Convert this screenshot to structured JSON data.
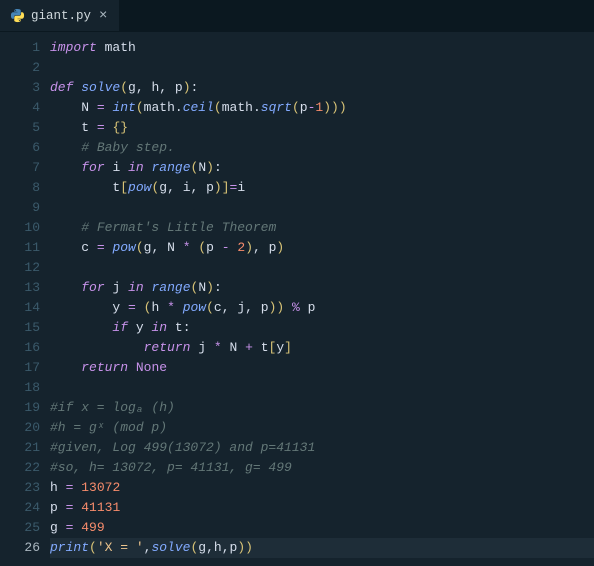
{
  "tab": {
    "filename": "giant.py",
    "icon": "python-icon",
    "close_glyph": "×"
  },
  "editor": {
    "current_line": 26,
    "lines": [
      {
        "n": 1,
        "tokens": [
          [
            "kw-import",
            "import"
          ],
          [
            "",
            ""
          ],
          [
            "ident",
            " math"
          ]
        ]
      },
      {
        "n": 2,
        "tokens": []
      },
      {
        "n": 3,
        "tokens": [
          [
            "kw-def",
            "def"
          ],
          [
            "",
            " "
          ],
          [
            "fn-name",
            "solve"
          ],
          [
            "punct",
            "("
          ],
          [
            "param",
            "g"
          ],
          [
            "punc-w",
            ", "
          ],
          [
            "param",
            "h"
          ],
          [
            "punc-w",
            ", "
          ],
          [
            "param",
            "p"
          ],
          [
            "punct",
            ")"
          ],
          [
            "punc-w",
            ":"
          ]
        ]
      },
      {
        "n": 4,
        "tokens": [
          [
            "",
            "    "
          ],
          [
            "ident",
            "N "
          ],
          [
            "op",
            "="
          ],
          [
            "",
            " "
          ],
          [
            "builtin",
            "int"
          ],
          [
            "punct",
            "("
          ],
          [
            "ident",
            "math"
          ],
          [
            "punc-w",
            "."
          ],
          [
            "fn-call",
            "ceil"
          ],
          [
            "punct",
            "("
          ],
          [
            "ident",
            "math"
          ],
          [
            "punc-w",
            "."
          ],
          [
            "fn-call",
            "sqrt"
          ],
          [
            "punct",
            "("
          ],
          [
            "ident",
            "p"
          ],
          [
            "op",
            "-"
          ],
          [
            "num",
            "1"
          ],
          [
            "punct",
            ")))"
          ]
        ]
      },
      {
        "n": 5,
        "tokens": [
          [
            "",
            "    "
          ],
          [
            "ident",
            "t "
          ],
          [
            "op",
            "="
          ],
          [
            "",
            " "
          ],
          [
            "brace",
            "{}"
          ]
        ]
      },
      {
        "n": 6,
        "tokens": [
          [
            "",
            "    "
          ],
          [
            "comment",
            "# Baby step."
          ]
        ]
      },
      {
        "n": 7,
        "tokens": [
          [
            "",
            "    "
          ],
          [
            "kw-flow",
            "for"
          ],
          [
            "",
            " "
          ],
          [
            "ident",
            "i"
          ],
          [
            "",
            " "
          ],
          [
            "kw-in",
            "in"
          ],
          [
            "",
            " "
          ],
          [
            "builtin",
            "range"
          ],
          [
            "punct",
            "("
          ],
          [
            "ident",
            "N"
          ],
          [
            "punct",
            ")"
          ],
          [
            "punc-w",
            ":"
          ]
        ]
      },
      {
        "n": 8,
        "tokens": [
          [
            "",
            "        "
          ],
          [
            "ident",
            "t"
          ],
          [
            "punct",
            "["
          ],
          [
            "builtin",
            "pow"
          ],
          [
            "punct",
            "("
          ],
          [
            "ident",
            "g"
          ],
          [
            "punc-w",
            ", "
          ],
          [
            "ident",
            "i"
          ],
          [
            "punc-w",
            ", "
          ],
          [
            "ident",
            "p"
          ],
          [
            "punct",
            ")]"
          ],
          [
            "op",
            "="
          ],
          [
            "ident",
            "i"
          ]
        ]
      },
      {
        "n": 9,
        "tokens": []
      },
      {
        "n": 10,
        "tokens": [
          [
            "",
            "    "
          ],
          [
            "comment",
            "# Fermat's Little Theorem"
          ]
        ]
      },
      {
        "n": 11,
        "tokens": [
          [
            "",
            "    "
          ],
          [
            "ident",
            "c "
          ],
          [
            "op",
            "="
          ],
          [
            "",
            " "
          ],
          [
            "builtin",
            "pow"
          ],
          [
            "punct",
            "("
          ],
          [
            "ident",
            "g"
          ],
          [
            "punc-w",
            ", "
          ],
          [
            "ident",
            "N "
          ],
          [
            "op",
            "*"
          ],
          [
            "",
            " "
          ],
          [
            "punct",
            "("
          ],
          [
            "ident",
            "p "
          ],
          [
            "op",
            "-"
          ],
          [
            "",
            " "
          ],
          [
            "num",
            "2"
          ],
          [
            "punct",
            ")"
          ],
          [
            "punc-w",
            ", "
          ],
          [
            "ident",
            "p"
          ],
          [
            "punct",
            ")"
          ]
        ]
      },
      {
        "n": 12,
        "tokens": []
      },
      {
        "n": 13,
        "tokens": [
          [
            "",
            "    "
          ],
          [
            "kw-flow",
            "for"
          ],
          [
            "",
            " "
          ],
          [
            "ident",
            "j"
          ],
          [
            "",
            " "
          ],
          [
            "kw-in",
            "in"
          ],
          [
            "",
            " "
          ],
          [
            "builtin",
            "range"
          ],
          [
            "punct",
            "("
          ],
          [
            "ident",
            "N"
          ],
          [
            "punct",
            ")"
          ],
          [
            "punc-w",
            ":"
          ]
        ]
      },
      {
        "n": 14,
        "tokens": [
          [
            "",
            "        "
          ],
          [
            "ident",
            "y "
          ],
          [
            "op",
            "="
          ],
          [
            "",
            " "
          ],
          [
            "punct",
            "("
          ],
          [
            "ident",
            "h "
          ],
          [
            "op",
            "*"
          ],
          [
            "",
            " "
          ],
          [
            "builtin",
            "pow"
          ],
          [
            "punct",
            "("
          ],
          [
            "ident",
            "c"
          ],
          [
            "punc-w",
            ", "
          ],
          [
            "ident",
            "j"
          ],
          [
            "punc-w",
            ", "
          ],
          [
            "ident",
            "p"
          ],
          [
            "punct",
            "))"
          ],
          [
            "",
            " "
          ],
          [
            "op",
            "%"
          ],
          [
            "",
            " "
          ],
          [
            "ident",
            "p"
          ]
        ]
      },
      {
        "n": 15,
        "tokens": [
          [
            "",
            "        "
          ],
          [
            "kw-flow",
            "if"
          ],
          [
            "",
            " "
          ],
          [
            "ident",
            "y"
          ],
          [
            "",
            " "
          ],
          [
            "kw-in",
            "in"
          ],
          [
            "",
            " "
          ],
          [
            "ident",
            "t"
          ],
          [
            "punc-w",
            ":"
          ]
        ]
      },
      {
        "n": 16,
        "tokens": [
          [
            "",
            "            "
          ],
          [
            "kw-flow",
            "return"
          ],
          [
            "",
            " "
          ],
          [
            "ident",
            "j "
          ],
          [
            "op",
            "*"
          ],
          [
            "",
            " "
          ],
          [
            "ident",
            "N "
          ],
          [
            "op",
            "+"
          ],
          [
            "",
            " "
          ],
          [
            "ident",
            "t"
          ],
          [
            "punct",
            "["
          ],
          [
            "ident",
            "y"
          ],
          [
            "punct",
            "]"
          ]
        ]
      },
      {
        "n": 17,
        "tokens": [
          [
            "",
            "    "
          ],
          [
            "kw-flow",
            "return"
          ],
          [
            "",
            " "
          ],
          [
            "const-none",
            "None"
          ]
        ]
      },
      {
        "n": 18,
        "tokens": []
      },
      {
        "n": 19,
        "tokens": [
          [
            "comment",
            "#if x = logₐ (h)"
          ]
        ]
      },
      {
        "n": 20,
        "tokens": [
          [
            "comment",
            "#h = gˣ (mod p)"
          ]
        ]
      },
      {
        "n": 21,
        "tokens": [
          [
            "comment",
            "#given, Log 499(13072) and p=41131"
          ]
        ]
      },
      {
        "n": 22,
        "tokens": [
          [
            "comment",
            "#so, h= 13072, p= 41131, g= 499"
          ]
        ]
      },
      {
        "n": 23,
        "tokens": [
          [
            "ident",
            "h "
          ],
          [
            "op",
            "="
          ],
          [
            "",
            " "
          ],
          [
            "num",
            "13072"
          ]
        ]
      },
      {
        "n": 24,
        "tokens": [
          [
            "ident",
            "p "
          ],
          [
            "op",
            "="
          ],
          [
            "",
            " "
          ],
          [
            "num",
            "41131"
          ]
        ]
      },
      {
        "n": 25,
        "tokens": [
          [
            "ident",
            "g "
          ],
          [
            "op",
            "="
          ],
          [
            "",
            " "
          ],
          [
            "num",
            "499"
          ]
        ]
      },
      {
        "n": 26,
        "tokens": [
          [
            "builtin",
            "print"
          ],
          [
            "punct",
            "("
          ],
          [
            "str",
            "'X = '"
          ],
          [
            "punc-w",
            ","
          ],
          [
            "fn-call",
            "solve"
          ],
          [
            "punct",
            "("
          ],
          [
            "ident",
            "g"
          ],
          [
            "punc-w",
            ","
          ],
          [
            "ident",
            "h"
          ],
          [
            "punc-w",
            ","
          ],
          [
            "ident",
            "p"
          ],
          [
            "punct",
            "))"
          ]
        ]
      }
    ]
  }
}
